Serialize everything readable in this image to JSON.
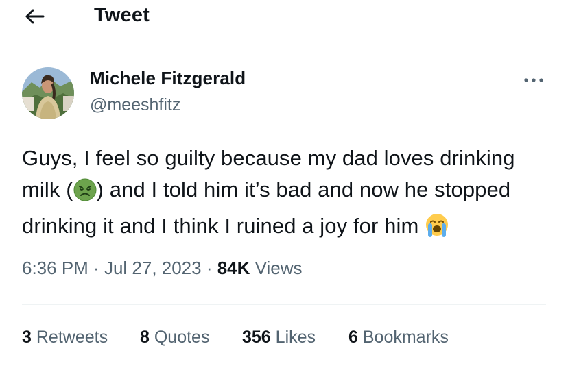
{
  "header": {
    "title": "Tweet",
    "back_icon": "arrow-left-icon"
  },
  "author": {
    "display_name": "Michele Fitzgerald",
    "handle": "@meeshfitz",
    "avatar_icon": "profile-photo"
  },
  "more_icon": "ellipsis-icon",
  "tweet": {
    "text_parts": [
      "Guys, I feel so guilty because my dad loves drinking milk (",
      ") and I told him it’s bad and now he stopped drinking it and I think I ruined a joy for him "
    ],
    "emojis": [
      "nauseated-face-emoji",
      "loudly-crying-face-emoji"
    ]
  },
  "meta": {
    "time": "6:36 PM",
    "separator": " · ",
    "date": "Jul 27, 2023",
    "views_count": "84K",
    "views_label": "Views"
  },
  "stats": {
    "retweets": {
      "count": "3",
      "label": "Retweets"
    },
    "quotes": {
      "count": "8",
      "label": "Quotes"
    },
    "likes": {
      "count": "356",
      "label": "Likes"
    },
    "bookmarks": {
      "count": "6",
      "label": "Bookmarks"
    }
  },
  "colors": {
    "text_primary": "#0f1419",
    "text_secondary": "#536471",
    "divider": "#eff3f4",
    "sick_emoji": "#6da34d",
    "crying_emoji": "#ffcc4d",
    "tears": "#5dadec"
  }
}
